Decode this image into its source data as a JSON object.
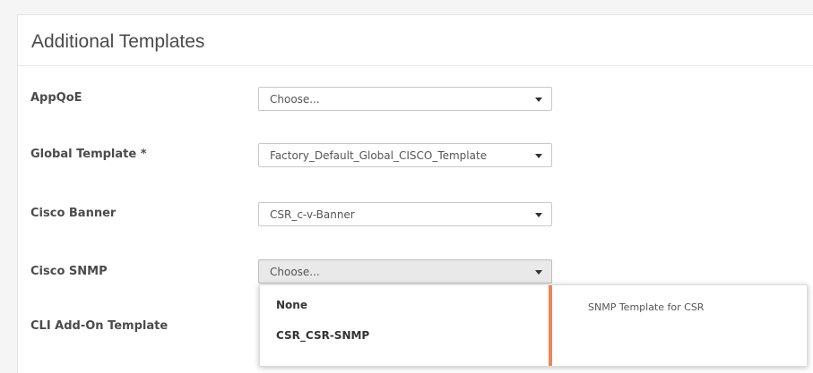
{
  "panel": {
    "title": "Additional Templates"
  },
  "rows": [
    {
      "label": "AppQoE",
      "value": "Choose..."
    },
    {
      "label": "Global Template *",
      "value": "Factory_Default_Global_CISCO_Template"
    },
    {
      "label": "Cisco Banner",
      "value": "CSR_c-v-Banner"
    },
    {
      "label": "Cisco SNMP",
      "value": "Choose..."
    },
    {
      "label": "CLI Add-On Template"
    }
  ],
  "dropdown": {
    "options": [
      "None",
      "CSR_CSR-SNMP"
    ],
    "description": "SNMP Template for CSR",
    "accent_color": "#e9875a"
  }
}
